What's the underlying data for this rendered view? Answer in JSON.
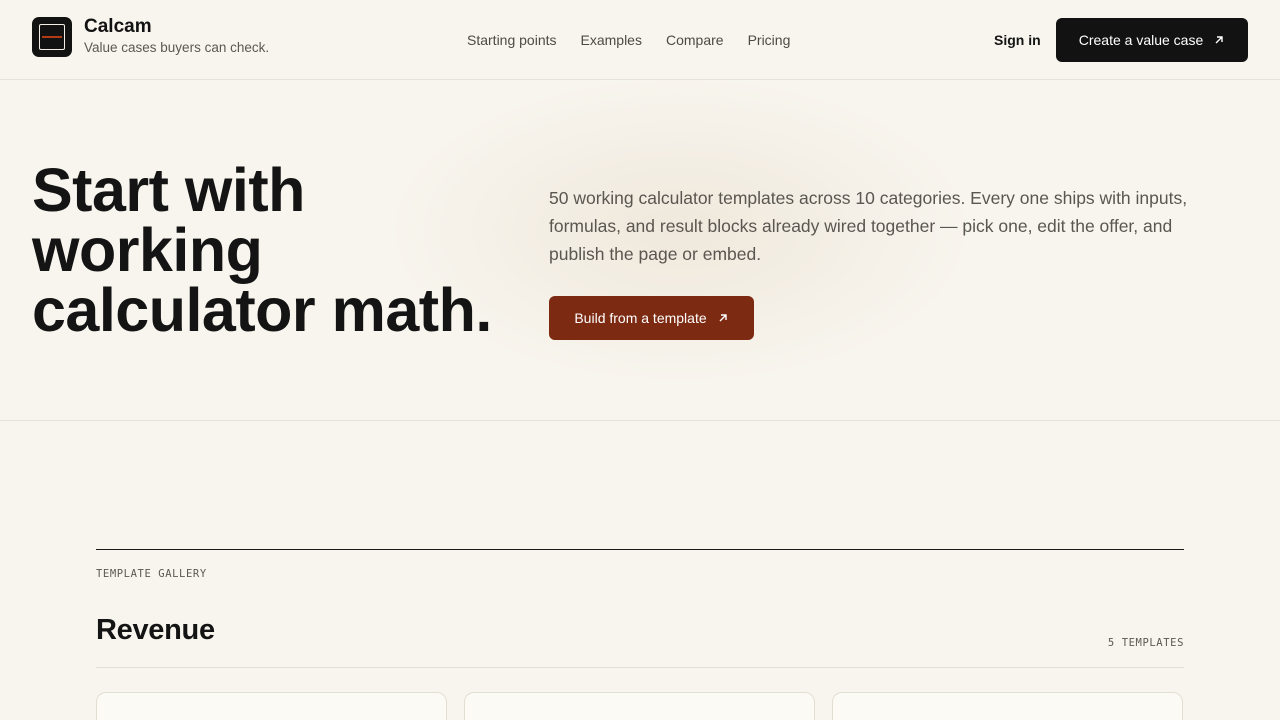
{
  "brand": {
    "name": "Calcam",
    "tagline": "Value cases buyers can check."
  },
  "nav": [
    {
      "label": "Starting points"
    },
    {
      "label": "Examples"
    },
    {
      "label": "Compare"
    },
    {
      "label": "Pricing"
    }
  ],
  "header": {
    "signin_label": "Sign in",
    "cta_label": "Create a value case"
  },
  "hero": {
    "title": "Start with working calculator math.",
    "description": "50 working calculator templates across 10 categories. Every one ships with inputs, formulas, and result blocks already wired together — pick one, edit the offer, and publish the page or embed.",
    "cta_label": "Build from a template"
  },
  "gallery": {
    "label": "TEMPLATE GALLERY",
    "section_title": "Revenue",
    "section_count": "5 TEMPLATES"
  },
  "colors": {
    "background": "#f8f5ee",
    "dark": "#121212",
    "accent": "#7d2a12",
    "logo_line": "#b33a16"
  },
  "icons": {
    "cta_arrow": "arrow-up-right-icon"
  }
}
